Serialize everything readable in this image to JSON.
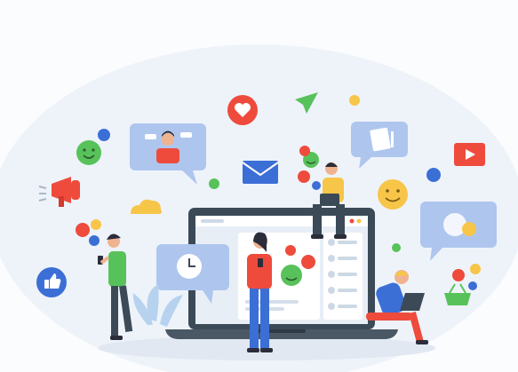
{
  "illustration": {
    "colors": {
      "background": "#f4f7fb",
      "laptop_frame": "#3c4a57",
      "screen": "#e8eef6",
      "bubble_blue": "#aec6ee",
      "accent_red": "#ee4b3c",
      "accent_green": "#58c25a",
      "accent_yellow": "#f7c548",
      "accent_blue": "#3b6fd6",
      "skin": "#f0b38f",
      "hair": "#2b2d3a"
    },
    "icons": [
      "heart-icon",
      "paper-plane-icon",
      "smiley-icon",
      "envelope-icon",
      "video-play-icon",
      "megaphone-icon",
      "cloud-icon",
      "thumbs-up-icon",
      "clock-icon",
      "coin-icon",
      "shopping-basket-icon"
    ]
  }
}
